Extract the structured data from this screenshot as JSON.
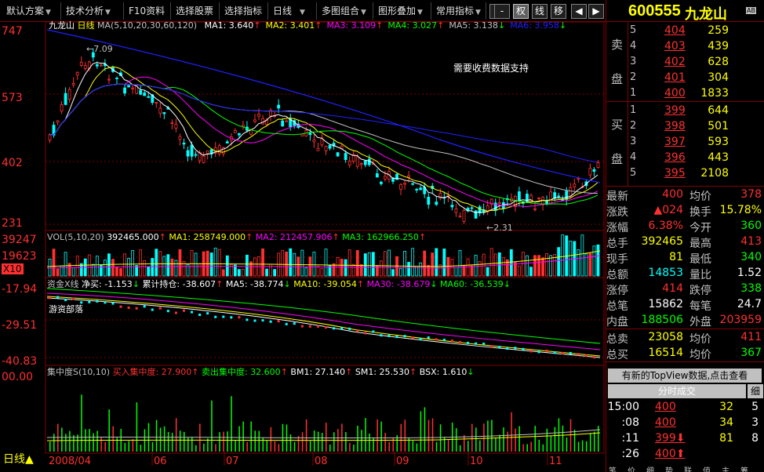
{
  "menubar": {
    "items": [
      "默认方案",
      "技术分析",
      "F10资料",
      "选择股票",
      "选择指标",
      "日线",
      "多图组合",
      "图形叠加",
      "常用指标"
    ],
    "squares": [
      "+",
      "-",
      "权",
      "线",
      "移",
      "◀",
      "▶"
    ]
  },
  "stock": {
    "code": "600555",
    "name": "九龙山",
    "badge": "AB"
  },
  "main_chart": {
    "title": "九龙山",
    "period": "日线",
    "ma_label": "MA(5,10,20,30,60,120)",
    "ma_values": [
      {
        "name": "MA1:",
        "value": "3.640",
        "color": "#ffffff"
      },
      {
        "name": "MA2:",
        "value": "3.401",
        "color": "#ffff00"
      },
      {
        "name": "MA3:",
        "value": "3.109",
        "color": "#ff00ff"
      },
      {
        "name": "MA4:",
        "value": "3.027",
        "color": "#00ff00"
      },
      {
        "name": "MA5:",
        "value": "3.138",
        "color": "#c0c0c0"
      },
      {
        "name": "MA6:",
        "value": "3.958",
        "color": "#2020ff"
      }
    ],
    "y_labels": [
      "747",
      "573",
      "402",
      "231"
    ],
    "high_note": "7.09",
    "low_note": "2.31",
    "notice": "需要收费数据支持"
  },
  "volume_panel": {
    "label": "VOL(5,10,20)",
    "value": "392465.000",
    "ma1": "MA1: 258749.000",
    "ma2": "MA2: 212457.906",
    "ma3": "MA3: 162966.250",
    "y_labels": [
      "39247",
      "19623",
      "X10"
    ]
  },
  "funds_panel": {
    "label": "资金X线",
    "net_buy": "净买: -1.153",
    "cumulative": "累计持仓: -38.607",
    "ma5": "MA5: -38.774",
    "ma10": "MA10: -39.054",
    "ma30": "MA30: -38.679",
    "ma60": "MA60: -36.539",
    "y_labels": [
      "-17.94",
      "-29.51",
      "-40.83"
    ],
    "note": "游资部落"
  },
  "concentration_panel": {
    "label": "集中度S(10,10)",
    "buy": "买入集中度: 27.900",
    "sell": "卖出集中度: 32.600",
    "bm1": "BM1: 27.140",
    "sm1": "SM1: 25.530",
    "bsx": "BSX: 1.610",
    "y_label": "00.00"
  },
  "date_axis": {
    "period_label": "日线",
    "dates": [
      "2008/04",
      "06",
      "07",
      "08",
      "09",
      "10",
      "11"
    ]
  },
  "order_book": {
    "sell_label": [
      "卖",
      "盘"
    ],
    "buy_label": [
      "买",
      "盘"
    ],
    "asks": [
      {
        "n": "5",
        "price": "404",
        "vol": "259"
      },
      {
        "n": "4",
        "price": "403",
        "vol": "439"
      },
      {
        "n": "3",
        "price": "402",
        "vol": "628"
      },
      {
        "n": "2",
        "price": "401",
        "vol": "304"
      },
      {
        "n": "1",
        "price": "400",
        "vol": "1833"
      }
    ],
    "bids": [
      {
        "n": "1",
        "price": "399",
        "vol": "644"
      },
      {
        "n": "2",
        "price": "398",
        "vol": "501"
      },
      {
        "n": "3",
        "price": "397",
        "vol": "593"
      },
      {
        "n": "4",
        "price": "396",
        "vol": "443"
      },
      {
        "n": "5",
        "price": "395",
        "vol": "2108"
      }
    ]
  },
  "quote": [
    {
      "k1": "最新",
      "v1": "400",
      "c1": "#ff3030",
      "k2": "均价",
      "v2": "378",
      "c2": "#ff3030"
    },
    {
      "k1": "涨跌",
      "v1": "▲024",
      "c1": "#ff3030",
      "k2": "换手",
      "v2": "15.78%",
      "c2": "#ffff00"
    },
    {
      "k1": "涨幅",
      "v1": "6.38%",
      "c1": "#ff3030",
      "k2": "今开",
      "v2": "360",
      "c2": "#00ff00"
    },
    {
      "k1": "总手",
      "v1": "392465",
      "c1": "#ffff00",
      "k2": "最高",
      "v2": "413",
      "c2": "#ff3030"
    },
    {
      "k1": "现手",
      "v1": "81",
      "c1": "#ffff00",
      "k2": "最低",
      "v2": "340",
      "c2": "#00ff00"
    },
    {
      "k1": "总额",
      "v1": "14853",
      "c1": "#00ffff",
      "k2": "量比",
      "v2": "1.52",
      "c2": "#ffffff"
    },
    {
      "k1": "涨停",
      "v1": "414",
      "c1": "#ff3030",
      "k2": "跌停",
      "v2": "338",
      "c2": "#00ff00"
    },
    {
      "k1": "总笔",
      "v1": "15862",
      "c1": "#ffffff",
      "k2": "每笔",
      "v2": "24.7",
      "c2": "#ffffff"
    },
    {
      "k1": "内盘",
      "v1": "188506",
      "c1": "#00ff00",
      "k2": "外盘",
      "v2": "203959",
      "c2": "#ff3030"
    }
  ],
  "totals": [
    {
      "k1": "总卖",
      "v1": "23058",
      "c1": "#ffff00",
      "k2": "均价",
      "v2": "411",
      "c2": "#ff3030"
    },
    {
      "k1": "总买",
      "v1": "16514",
      "c1": "#ffff00",
      "k2": "均价",
      "v2": "367",
      "c2": "#00ff00"
    }
  ],
  "topview": "有新的TopView数据,点击查看",
  "trades_title": "分时成交",
  "trades_tab": "细",
  "trades": [
    {
      "time": "15:00",
      "price": "400",
      "vol": "32",
      "n": "5",
      "arrow": ""
    },
    {
      "time": ":08",
      "price": "400",
      "vol": "34",
      "n": "3",
      "arrow": ""
    },
    {
      "time": ":11",
      "price": "399",
      "vol": "81",
      "n": "8",
      "arrow": "⬇"
    },
    {
      "time": ":26",
      "price": "400",
      "vol": "",
      "n": "",
      "arrow": "⬆"
    }
  ],
  "bottom_tabs": [
    "笔",
    "价",
    "细",
    "势",
    "联",
    "值",
    "主",
    "筹"
  ]
}
